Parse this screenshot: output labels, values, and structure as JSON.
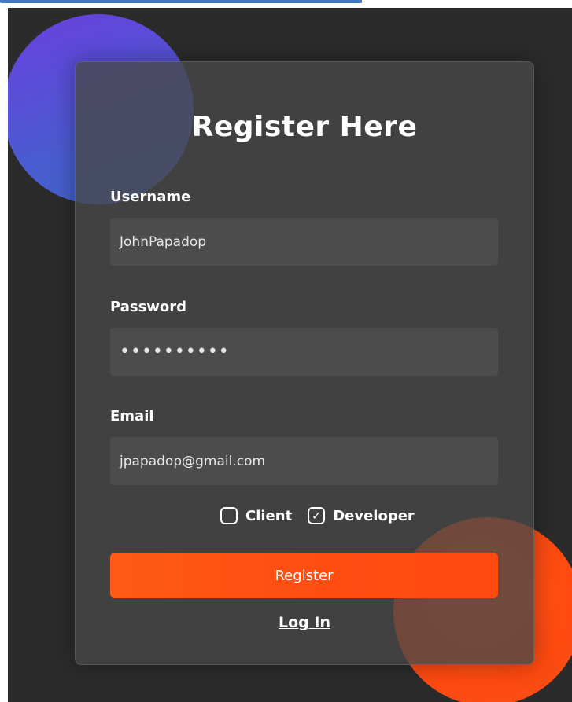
{
  "form": {
    "title": "Register Here",
    "username": {
      "label": "Username",
      "value": "JohnPapadop"
    },
    "password": {
      "label": "Password",
      "value": "••••••••••"
    },
    "email": {
      "label": "Email",
      "value": "jpapadop@gmail.com"
    },
    "roles": [
      {
        "label": "Client",
        "checked": false
      },
      {
        "label": "Developer",
        "checked": true
      }
    ],
    "register_label": "Register",
    "login_label": "Log In"
  },
  "colors": {
    "background": "#2b2b2b",
    "card": "#484848",
    "field": "#4c4c4c",
    "accent": "#ff4d12",
    "blob_purple": "#5b48d6",
    "blob_orange": "#ff5316"
  },
  "icons": {
    "check": "check-icon"
  }
}
